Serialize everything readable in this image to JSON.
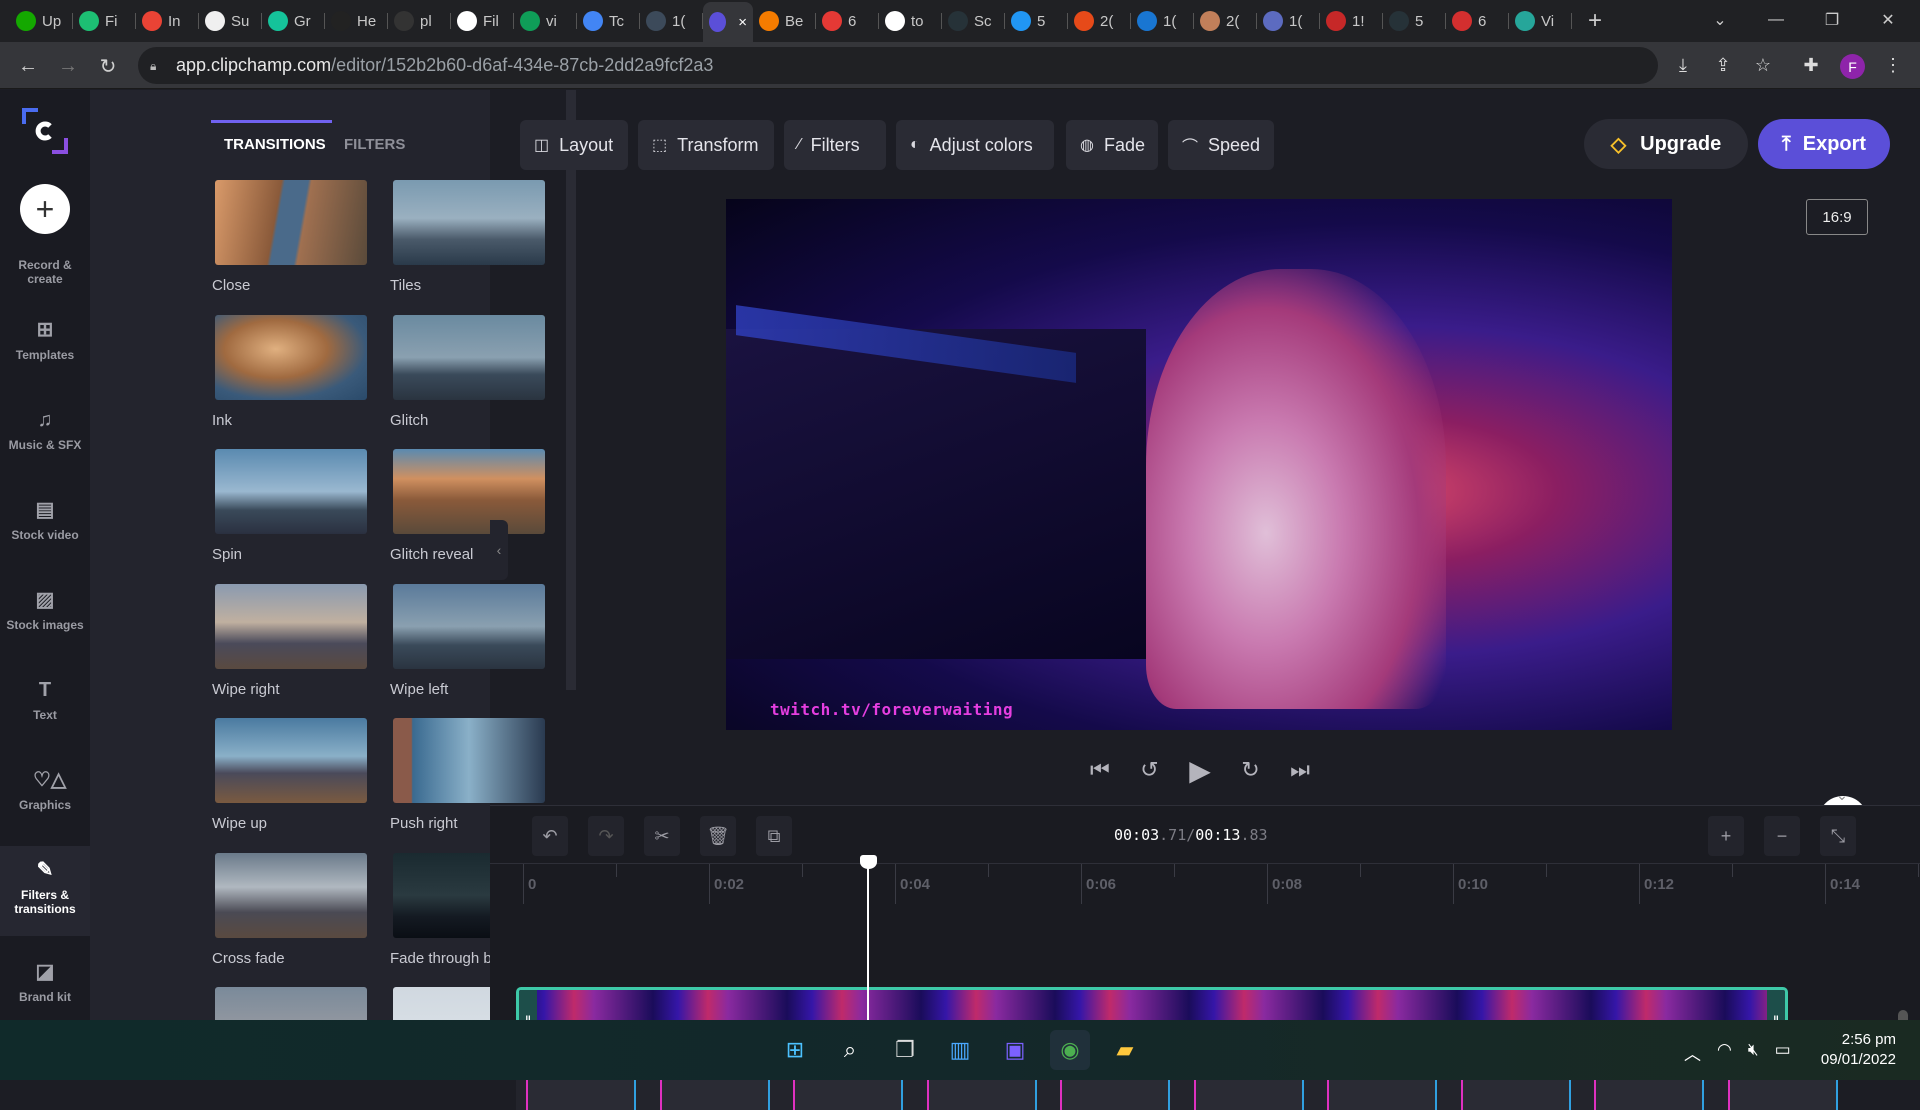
{
  "browser": {
    "tabs": [
      {
        "icon": "upwork-icon",
        "label": "Up",
        "color": "#14a800"
      },
      {
        "icon": "fiverr-icon",
        "label": "Fi",
        "color": "#1dbf73"
      },
      {
        "icon": "gmail-icon",
        "label": "In",
        "color": "#ea4335"
      },
      {
        "icon": "survey-icon",
        "label": "Su",
        "color": "#f0f0f0"
      },
      {
        "icon": "grammarly-icon",
        "label": "Gr",
        "color": "#15c39a"
      },
      {
        "icon": "h-icon",
        "label": "He",
        "color": "#222222"
      },
      {
        "icon": "printer-icon",
        "label": "pl",
        "color": "#333333"
      },
      {
        "icon": "t-icon",
        "label": "Fil",
        "color": "#ffffff"
      },
      {
        "icon": "sheets-plus-icon",
        "label": "vi",
        "color": "#0f9d58"
      },
      {
        "icon": "docs-icon",
        "label": "Tc",
        "color": "#4285f4"
      },
      {
        "icon": "circle-6-icon",
        "label": "1(",
        "color": "#3c4a5a"
      },
      {
        "icon": "clipchamp-icon",
        "label": "",
        "color": "#5b4fd8",
        "active": true
      },
      {
        "icon": "f-icon",
        "label": "Be",
        "color": "#f57c00"
      },
      {
        "icon": "c-icon",
        "label": "6",
        "color": "#e53935"
      },
      {
        "icon": "google-icon",
        "label": "to",
        "color": "#ffffff"
      },
      {
        "icon": "arrow-icon",
        "label": "Sc",
        "color": "#263238"
      },
      {
        "icon": "dots-icon",
        "label": "5",
        "color": "#2196f3"
      },
      {
        "icon": "swirl-icon",
        "label": "2(",
        "color": "#e64a19"
      },
      {
        "icon": "avatar-tab-icon",
        "label": "1(",
        "color": "#1976d2"
      },
      {
        "icon": "ai-icon",
        "label": "2(",
        "color": "#c17f5a"
      },
      {
        "icon": "reel-icon",
        "label": "1(",
        "color": "#5c6bc0"
      },
      {
        "icon": "tm-icon",
        "label": "1!",
        "color": "#c62828"
      },
      {
        "icon": "arrow-icon",
        "label": "5",
        "color": "#263238"
      },
      {
        "icon": "pdf-icon",
        "label": "6",
        "color": "#d32f2f"
      },
      {
        "icon": "figure-icon",
        "label": "Vi",
        "color": "#26a69a"
      }
    ],
    "active_tab_close": "×",
    "new_tab": "+",
    "url_host": "app.clipchamp.com",
    "url_path": "/editor/152b2b60-d6af-434e-87cb-2dd2a9fcf2a3",
    "profile_initial": "F"
  },
  "rail": {
    "create_label": "Record & create",
    "items": [
      {
        "icon": "templates-icon",
        "glyph": "⊞",
        "label": "Templates"
      },
      {
        "icon": "music-icon",
        "glyph": "♫",
        "label": "Music & SFX"
      },
      {
        "icon": "film-icon",
        "glyph": "▤",
        "label": "Stock video"
      },
      {
        "icon": "image-icon",
        "glyph": "▨",
        "label": "Stock images"
      },
      {
        "icon": "text-icon",
        "glyph": "T",
        "label": "Text"
      },
      {
        "icon": "shapes-icon",
        "glyph": "♡△",
        "label": "Graphics"
      },
      {
        "icon": "magic-wand-icon",
        "glyph": "✎",
        "label": "Filters & transitions",
        "active": true
      },
      {
        "icon": "brand-kit-icon",
        "glyph": "◪",
        "label": "Brand kit"
      }
    ]
  },
  "panel": {
    "tabs": [
      "TRANSITIONS",
      "FILTERS"
    ],
    "active_tab": "TRANSITIONS",
    "transitions": [
      {
        "label": "Close"
      },
      {
        "label": "Tiles"
      },
      {
        "label": "Ink"
      },
      {
        "label": "Glitch"
      },
      {
        "label": "Spin"
      },
      {
        "label": "Glitch reveal"
      },
      {
        "label": "Wipe right"
      },
      {
        "label": "Wipe left"
      },
      {
        "label": "Wipe up"
      },
      {
        "label": "Push right"
      },
      {
        "label": "Cross fade"
      },
      {
        "label": "Fade through black"
      },
      {
        "label": ""
      },
      {
        "label": ""
      }
    ]
  },
  "toolbar": {
    "buttons": [
      {
        "icon": "layout-icon",
        "glyph": "◫",
        "label": "Layout"
      },
      {
        "icon": "transform-icon",
        "glyph": "⬚",
        "label": "Transform"
      },
      {
        "icon": "filters-wand-icon",
        "glyph": "⁄",
        "label": "Filters"
      },
      {
        "icon": "adjust-colors-icon",
        "glyph": "◐",
        "label": "Adjust colors"
      },
      {
        "icon": "fade-icon",
        "glyph": "◍",
        "label": "Fade"
      },
      {
        "icon": "speed-icon",
        "glyph": "⌒",
        "label": "Speed"
      }
    ],
    "upgrade_label": "Upgrade",
    "export_label": "Export",
    "aspect_ratio": "16:9"
  },
  "preview": {
    "watermark": "twitch.tv/foreverwaiting"
  },
  "timeline": {
    "current_main": "00:03",
    "current_frac": ".71",
    "separator": "/",
    "total_main": "00:13",
    "total_frac": ".83",
    "ruler_labels": [
      "0",
      "0:02",
      "0:04",
      "0:06",
      "0:08",
      "0:10",
      "0:12",
      "0:14"
    ],
    "playhead_seconds": 3.71
  },
  "taskbar": {
    "apps": [
      {
        "icon": "windows-start-icon"
      },
      {
        "icon": "search-icon"
      },
      {
        "icon": "task-view-icon"
      },
      {
        "icon": "widgets-icon"
      },
      {
        "icon": "teams-chat-icon"
      },
      {
        "icon": "chrome-icon"
      },
      {
        "icon": "file-explorer-icon"
      }
    ],
    "time": "2:56 pm",
    "date": "09/01/2022"
  }
}
